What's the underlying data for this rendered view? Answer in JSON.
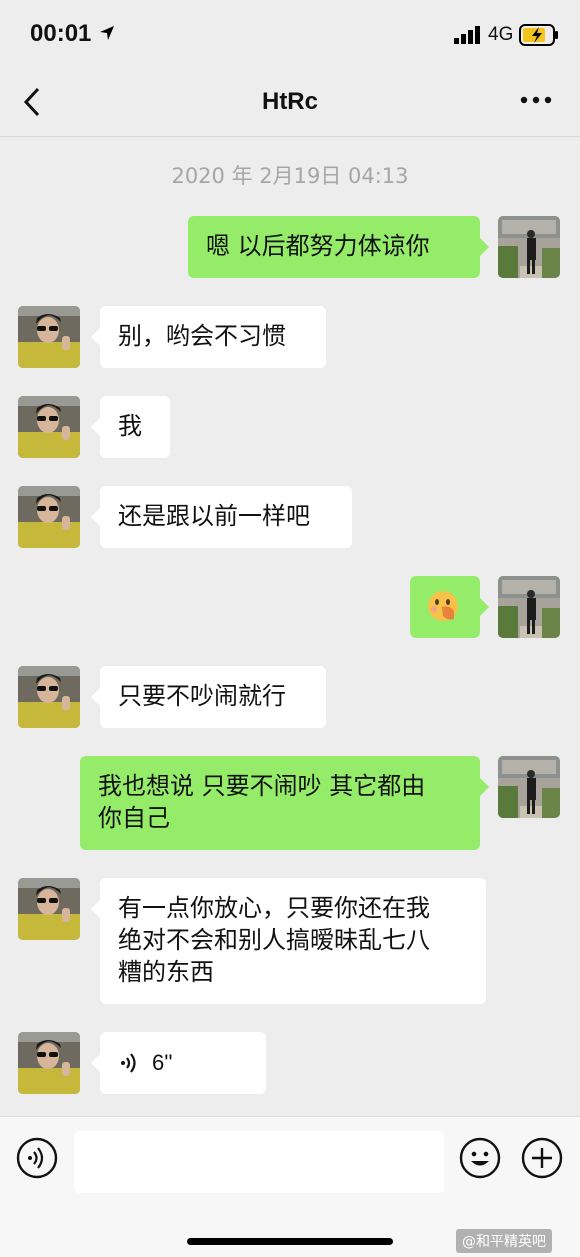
{
  "status": {
    "time": "00:01",
    "network": "4G"
  },
  "nav": {
    "title": "HtRc"
  },
  "timestamp": "2020 年 2月19日 04:13",
  "messages": [
    {
      "side": "out",
      "text": "嗯 以后都努力体谅你"
    },
    {
      "side": "in",
      "text": "别，哟会不习惯"
    },
    {
      "side": "in",
      "text": "我"
    },
    {
      "side": "in",
      "text": "还是跟以前一样吧"
    },
    {
      "side": "out",
      "text": "😮"
    },
    {
      "side": "in",
      "text": "只要不吵闹就行"
    },
    {
      "side": "out",
      "line1": "我也想说 只要不闹吵 其它都由",
      "line2": "你自己"
    },
    {
      "side": "in",
      "line1": "有一点你放心，只要你还在我",
      "line2": "绝对不会和别人搞暧昧乱七八",
      "line3": "糟的东西"
    },
    {
      "side": "in",
      "type": "voice",
      "duration": "6''"
    }
  ],
  "watermark": "@和平精英吧",
  "colors": {
    "out_bubble": "#95ec69",
    "in_bubble": "#ffffff",
    "background": "#ededed"
  }
}
